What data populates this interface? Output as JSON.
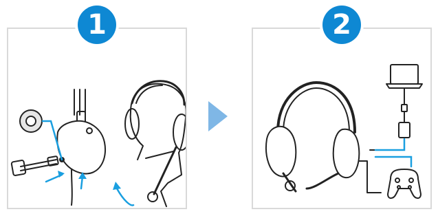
{
  "steps": [
    {
      "number": "1",
      "icon": "attach-microphone-illustration"
    },
    {
      "number": "2",
      "icon": "connect-cable-illustration"
    }
  ],
  "arrow_icon": "next-step-arrow-icon",
  "colors": {
    "badge": "#0e88d3",
    "arrow": "#7fb7e6",
    "accent_line": "#1a9fe0",
    "stroke": "#222222",
    "panel_border": "#d9d9d9"
  }
}
